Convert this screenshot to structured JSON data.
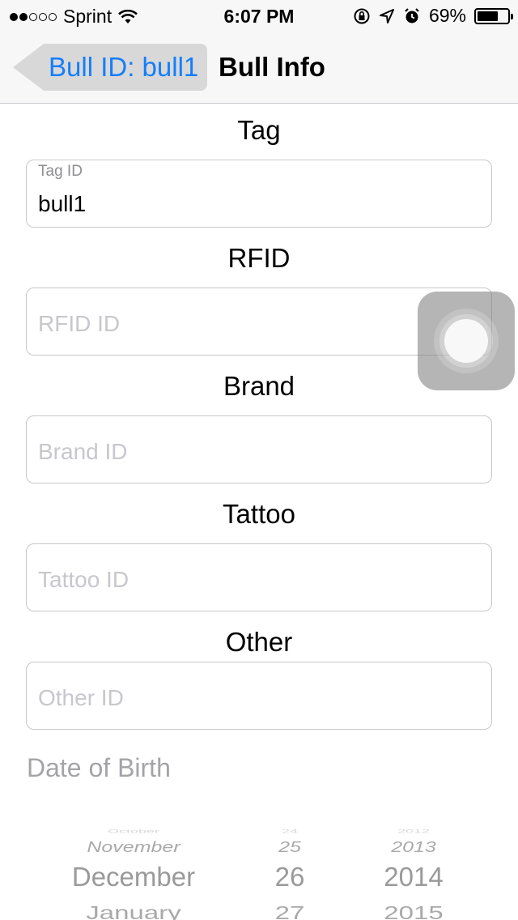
{
  "status_bar": {
    "carrier": "Sprint",
    "time": "6:07 PM",
    "battery_text": "69%",
    "battery_level": 0.69,
    "signal_dots_filled": 2,
    "signal_dots_total": 5,
    "icons": [
      "wifi-icon",
      "orientation-lock-icon",
      "location-icon",
      "alarm-icon",
      "battery-icon"
    ]
  },
  "nav": {
    "back_label": "Bull ID: bull1",
    "title": "Bull Info"
  },
  "form": {
    "tag": {
      "title": "Tag",
      "floating_label": "Tag ID",
      "value": "bull1"
    },
    "rfid": {
      "title": "RFID",
      "placeholder": "RFID ID",
      "value": ""
    },
    "brand": {
      "title": "Brand",
      "placeholder": "Brand ID",
      "value": ""
    },
    "tattoo": {
      "title": "Tattoo",
      "placeholder": "Tattoo ID",
      "value": ""
    },
    "other": {
      "title": "Other",
      "placeholder": "Other ID",
      "value": ""
    },
    "dob_label": "Date of Birth"
  },
  "date_picker": {
    "months": [
      "October",
      "November",
      "December",
      "January"
    ],
    "days": [
      "24",
      "25",
      "26",
      "27"
    ],
    "years": [
      "2012",
      "2013",
      "2014",
      "2015"
    ],
    "selected": {
      "month": "December",
      "day": "26",
      "year": "2014"
    }
  },
  "colors": {
    "accent": "#147efb",
    "placeholder": "#c7c7cd",
    "border": "#c8c7cc",
    "bar_background": "#f7f7f7"
  }
}
